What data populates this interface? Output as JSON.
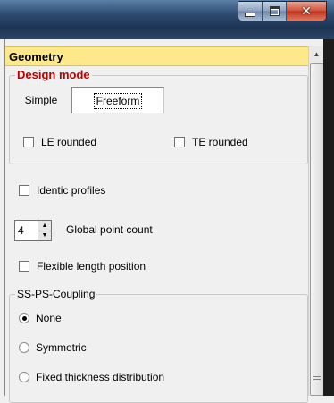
{
  "window": {
    "buttons": {
      "minimize": "minimize",
      "maximize": "maximize",
      "close": "close"
    }
  },
  "panel": {
    "header": "Geometry",
    "design_mode": {
      "title": "Design mode",
      "tabs": [
        {
          "label": "Simple",
          "selected": false
        },
        {
          "label": "Freeform",
          "selected": true
        }
      ],
      "le_rounded": {
        "label": "LE rounded",
        "checked": false
      },
      "te_rounded": {
        "label": "TE rounded",
        "checked": false
      }
    },
    "identic_profiles": {
      "label": "Identic profiles",
      "checked": false
    },
    "global_point_count": {
      "label": "Global point count",
      "value": "4"
    },
    "flexible_length_position": {
      "label": "Flexible length position",
      "checked": false
    },
    "coupling": {
      "title": "SS-PS-Coupling",
      "options": [
        {
          "label": "None",
          "selected": true
        },
        {
          "label": "Symmetric",
          "selected": false
        },
        {
          "label": "Fixed thickness distribution",
          "selected": false
        }
      ]
    }
  },
  "colors": {
    "header_bg": "#fde98a",
    "design_mode_title": "#c00000"
  },
  "icons": {
    "scroll_up": "scroll-up-icon",
    "spin_up": "spin-up-icon",
    "spin_down": "spin-down-icon"
  }
}
